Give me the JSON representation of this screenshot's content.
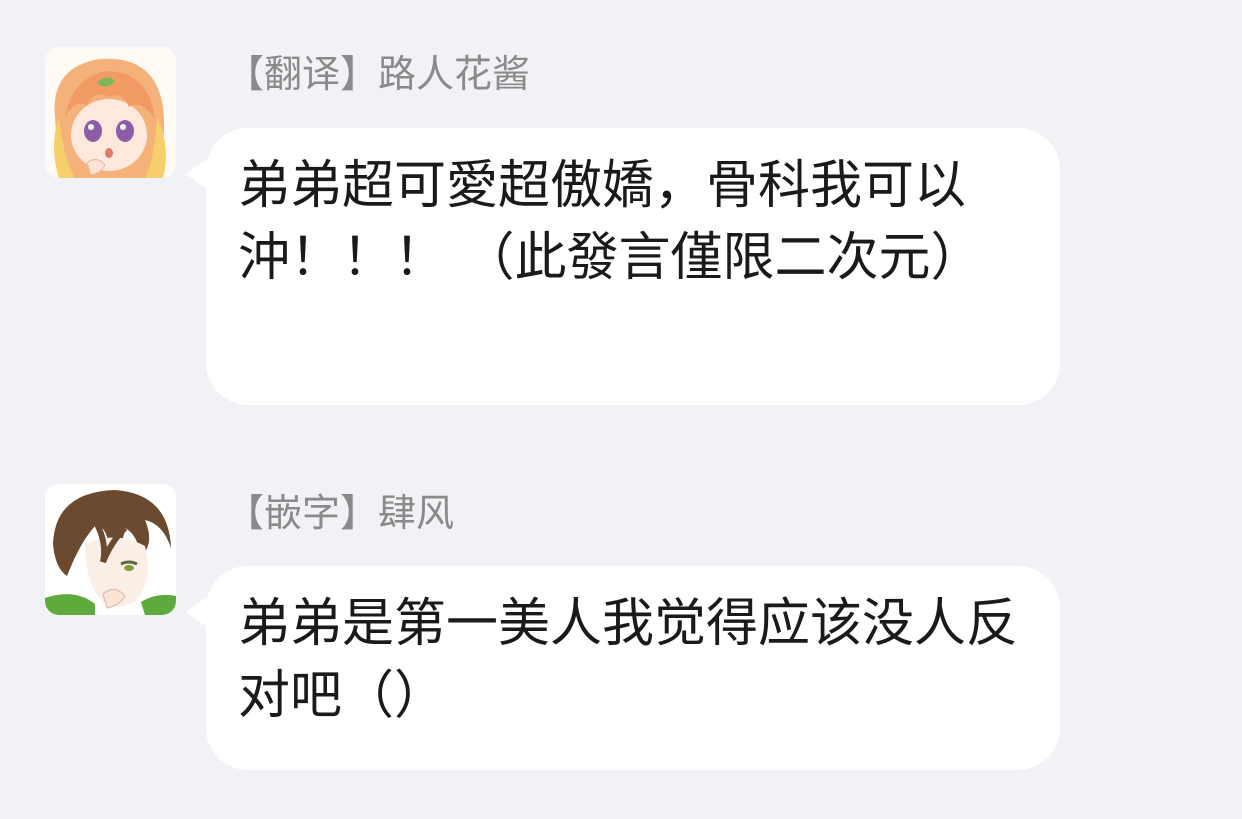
{
  "messages": [
    {
      "sender": "【翻译】路人花酱",
      "text": "弟弟超可愛超傲嬌，骨科我可以沖！！！ （此發言僅限二次元）"
    },
    {
      "sender": "【嵌字】肆风",
      "text": "弟弟是第一美人我觉得应该没人反对吧（）"
    }
  ]
}
